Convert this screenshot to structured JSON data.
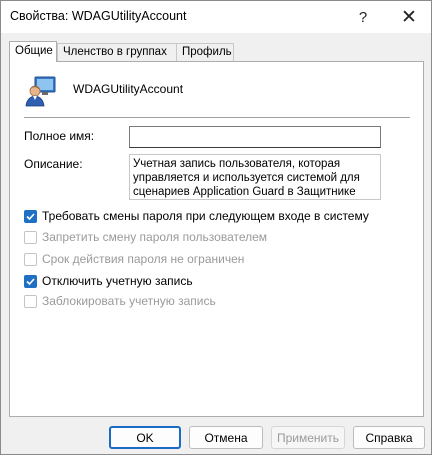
{
  "window": {
    "title": "Свойства: WDAGUtilityAccount",
    "help_glyph": "?",
    "close_glyph": "✕"
  },
  "tabs": [
    {
      "label": "Общие",
      "active": true
    },
    {
      "label": "Членство в группах",
      "active": false
    },
    {
      "label": "Профиль",
      "active": false
    }
  ],
  "general": {
    "account_name": "WDAGUtilityAccount",
    "user_icon": "user-account-icon",
    "full_name_label": "Полное имя:",
    "full_name_value": "",
    "description_label": "Описание:",
    "description_value": "Учетная запись пользователя, которая\nуправляется и используется системой для\nсценариев Application Guard в Защитнике",
    "checkboxes": [
      {
        "label": "Требовать смены пароля при следующем входе в систему",
        "checked": true,
        "enabled": true
      },
      {
        "label": "Запретить смену пароля пользователем",
        "checked": false,
        "enabled": false
      },
      {
        "label": "Срок действия пароля не ограничен",
        "checked": false,
        "enabled": false
      },
      {
        "label": "Отключить учетную запись",
        "checked": true,
        "enabled": true
      },
      {
        "label": "Заблокировать учетную запись",
        "checked": false,
        "enabled": false
      }
    ]
  },
  "buttons": {
    "ok": "OK",
    "cancel": "Отмена",
    "apply": "Применить",
    "help": "Справка"
  },
  "colors": {
    "accent": "#1f6fc5",
    "disabled_text": "#9a9a9a"
  }
}
